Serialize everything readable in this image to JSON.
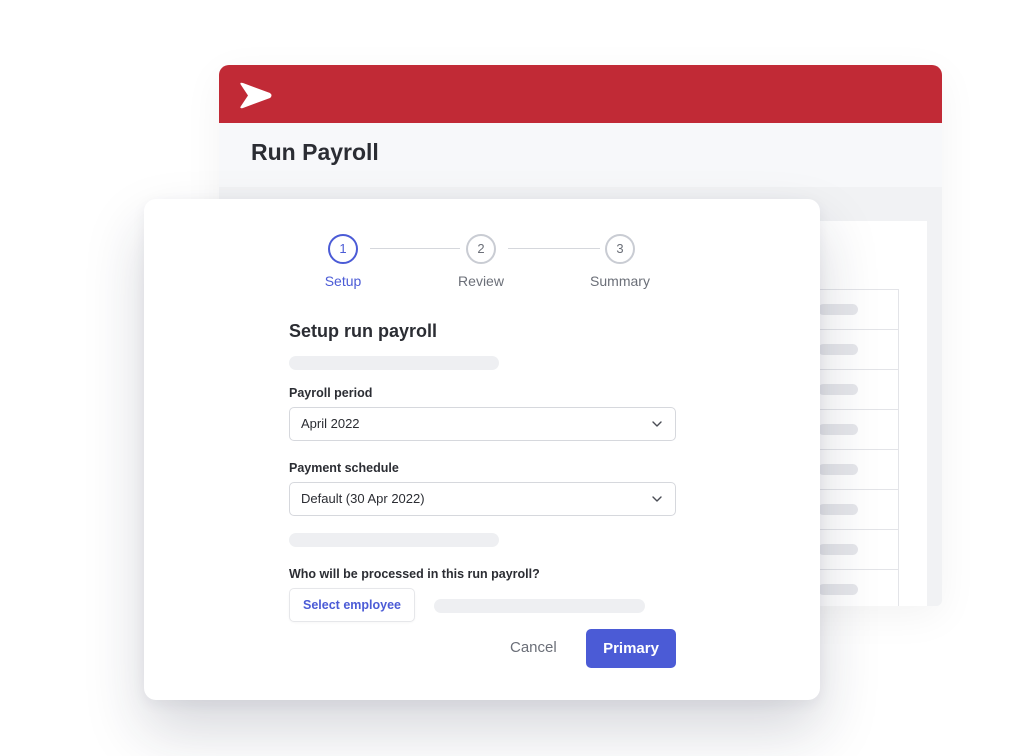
{
  "app": {
    "title": "Run Payroll",
    "brand_color": "#c12a36",
    "logo_icon": "chevron-logo-icon"
  },
  "stepper": {
    "steps": [
      {
        "number": "1",
        "label": "Setup",
        "active": true
      },
      {
        "number": "2",
        "label": "Review",
        "active": false
      },
      {
        "number": "3",
        "label": "Summary",
        "active": false
      }
    ],
    "accent_color": "#4b5bd6"
  },
  "form": {
    "title": "Setup run payroll",
    "payroll_period": {
      "label": "Payroll period",
      "value": "April 2022"
    },
    "payment_schedule": {
      "label": "Payment schedule",
      "value": "Default (30 Apr 2022)"
    },
    "question": "Who will be processed in this run payroll?",
    "select_employee_label": "Select employee"
  },
  "actions": {
    "cancel_label": "Cancel",
    "primary_label": "Primary"
  }
}
